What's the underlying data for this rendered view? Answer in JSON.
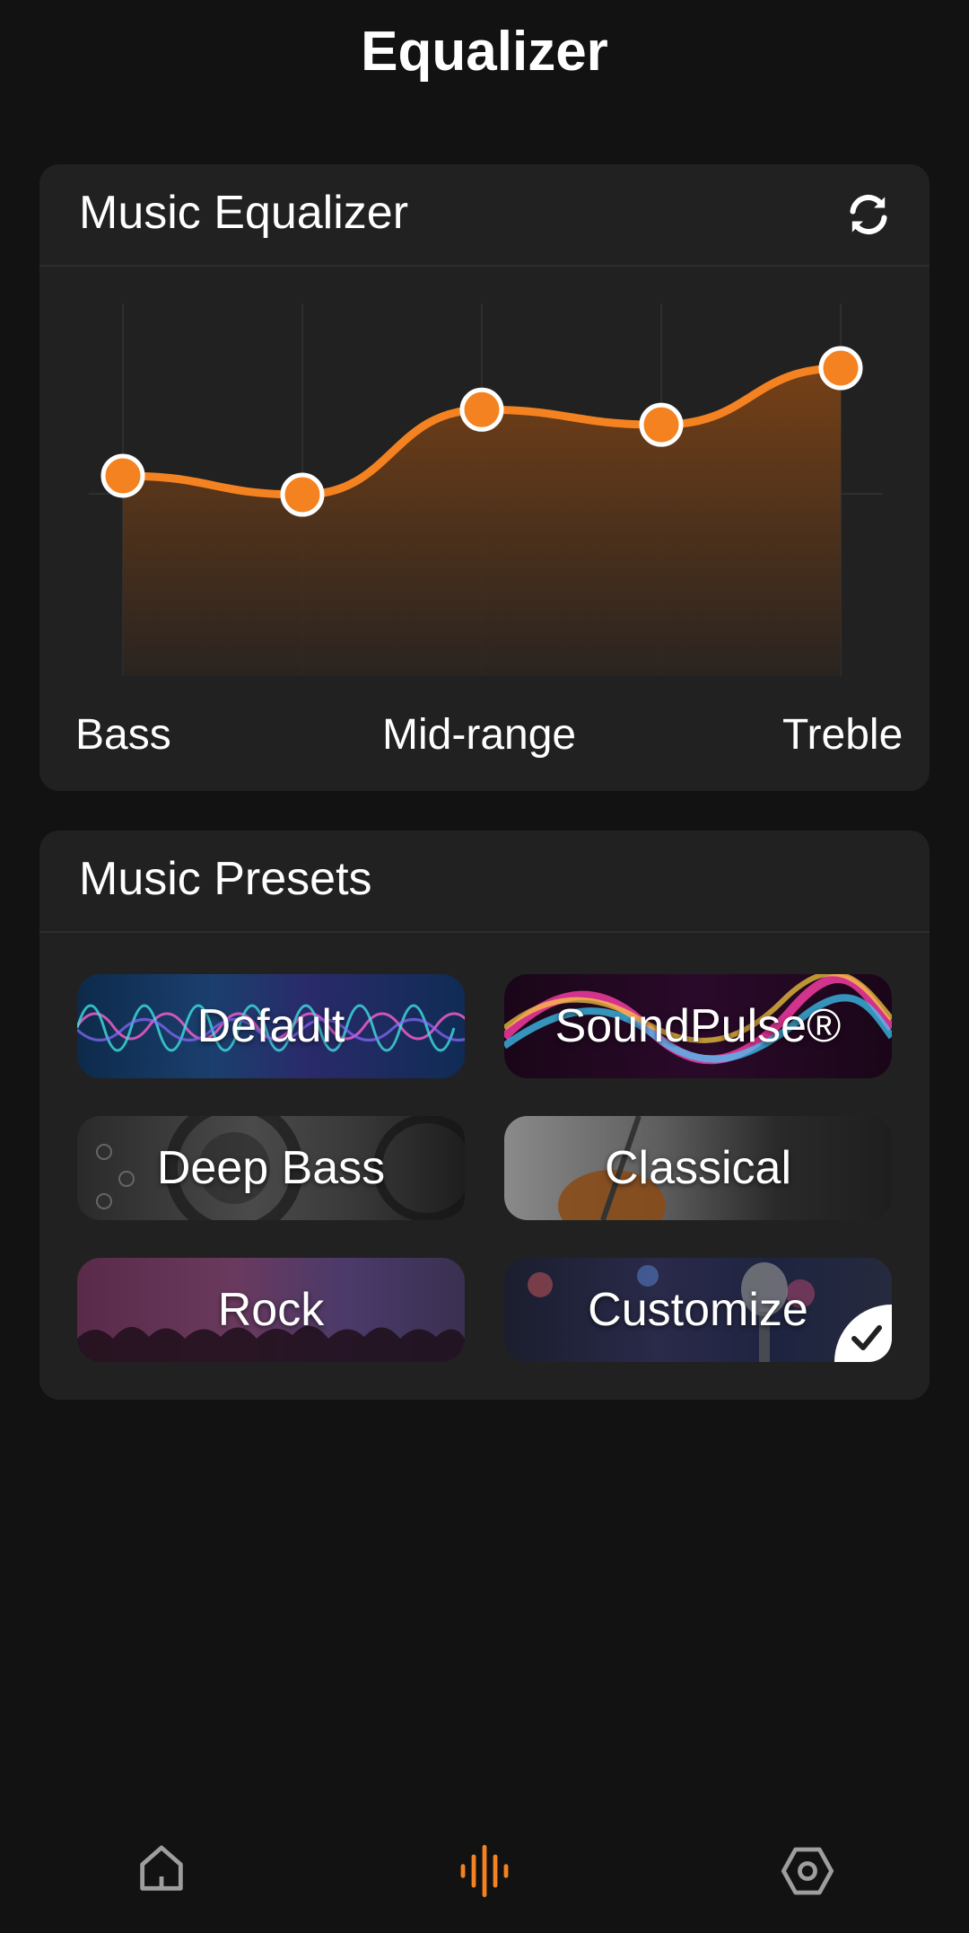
{
  "header": {
    "title": "Equalizer"
  },
  "equalizer_card": {
    "title": "Music Equalizer",
    "reset_icon": "refresh-icon",
    "band_labels": {
      "bass": "Bass",
      "mid": "Mid-range",
      "treble": "Treble"
    },
    "levels": [
      0.1,
      0.0,
      0.45,
      0.37,
      0.67
    ],
    "accent_color": "#F58220"
  },
  "presets_card": {
    "title": "Music Presets",
    "presets": [
      {
        "label": "Default",
        "selected": false
      },
      {
        "label": "SoundPulse®",
        "selected": false
      },
      {
        "label": "Deep Bass",
        "selected": false
      },
      {
        "label": "Classical",
        "selected": false
      },
      {
        "label": "Rock",
        "selected": false
      },
      {
        "label": "Customize",
        "selected": true
      }
    ]
  },
  "bottom_nav": {
    "items": [
      {
        "icon": "home-icon",
        "active": false
      },
      {
        "icon": "equalizer-icon",
        "active": true
      },
      {
        "icon": "settings-icon",
        "active": false
      }
    ],
    "active_color": "#F58220",
    "inactive_color": "#9e9e9e"
  }
}
